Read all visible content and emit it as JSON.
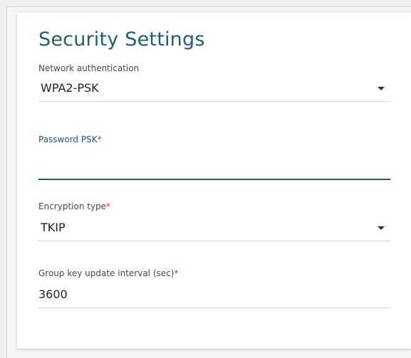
{
  "card": {
    "title": "Security Settings"
  },
  "fields": {
    "network_auth": {
      "label": "Network authentication",
      "value": "WPA2-PSK"
    },
    "password_psk": {
      "label": "Password PSK",
      "required_mark": "*",
      "value": ""
    },
    "encryption_type": {
      "label": "Encryption type",
      "required_mark": "*",
      "value": "TKIP"
    },
    "group_key_interval": {
      "label": "Group key update interval (sec)",
      "required_mark": "*",
      "value": "3600"
    }
  },
  "colors": {
    "accent": "#1d5f75",
    "required": "#d0342c"
  },
  "icons": {
    "dropdown": "caret-down-icon"
  }
}
